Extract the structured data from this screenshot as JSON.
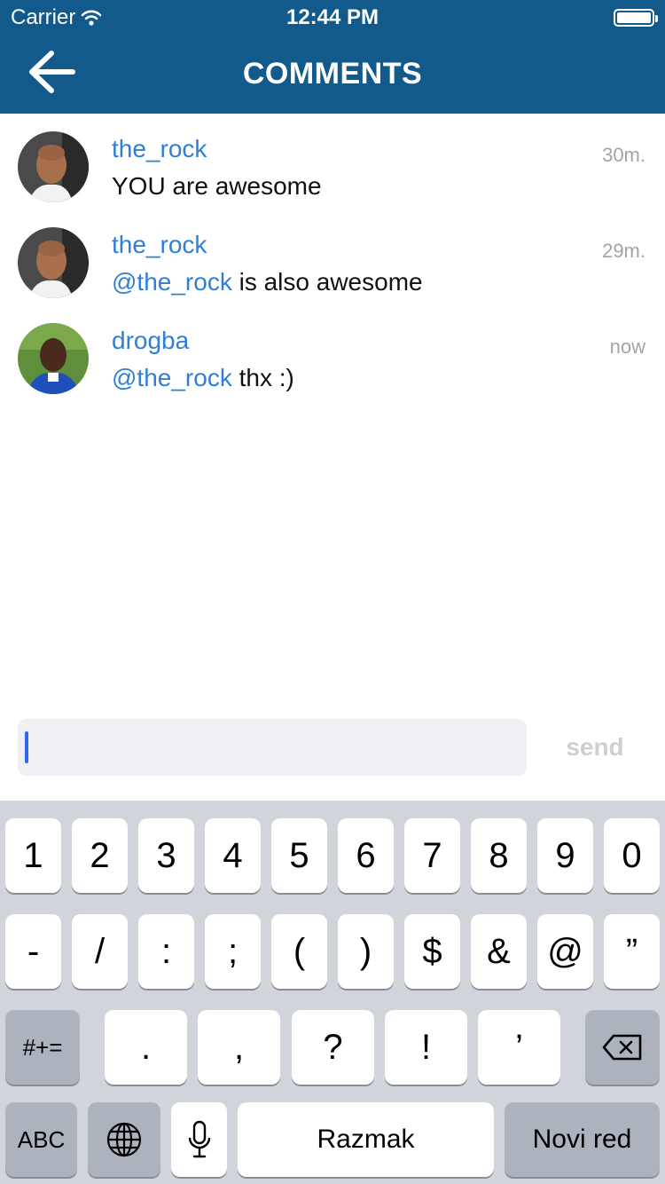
{
  "status_bar": {
    "carrier": "Carrier",
    "time": "12:44 PM",
    "wifi_icon": "wifi-icon",
    "battery_icon": "battery-icon"
  },
  "nav": {
    "back_icon": "arrow-left-icon",
    "title": "COMMENTS"
  },
  "colors": {
    "nav_bg": "#135a8c",
    "link": "#2f7fd9",
    "keyboard_bg": "#d1d5db"
  },
  "comments": [
    {
      "user": "the_rock",
      "time": "30m.",
      "mention": "",
      "text": "YOU are awesome"
    },
    {
      "user": "the_rock",
      "time": "29m.",
      "mention": "@the_rock",
      "text": " is also awesome"
    },
    {
      "user": "drogba",
      "time": "now",
      "mention": "@the_rock",
      "text": " thx :)"
    }
  ],
  "composer": {
    "value": "",
    "send_label": "send"
  },
  "keyboard": {
    "row1": [
      "1",
      "2",
      "3",
      "4",
      "5",
      "6",
      "7",
      "8",
      "9",
      "0"
    ],
    "row2": [
      "-",
      "/",
      ":",
      ";",
      "(",
      ")",
      "$",
      "&",
      "@",
      "”"
    ],
    "row3": [
      ".",
      ",",
      "?",
      "!",
      "’"
    ],
    "shift_label": "#+=",
    "backspace_icon": "backspace-icon",
    "abc_label": "ABC",
    "globe_icon": "globe-icon",
    "mic_icon": "microphone-icon",
    "space_label": "Razmak",
    "return_label": "Novi red"
  }
}
